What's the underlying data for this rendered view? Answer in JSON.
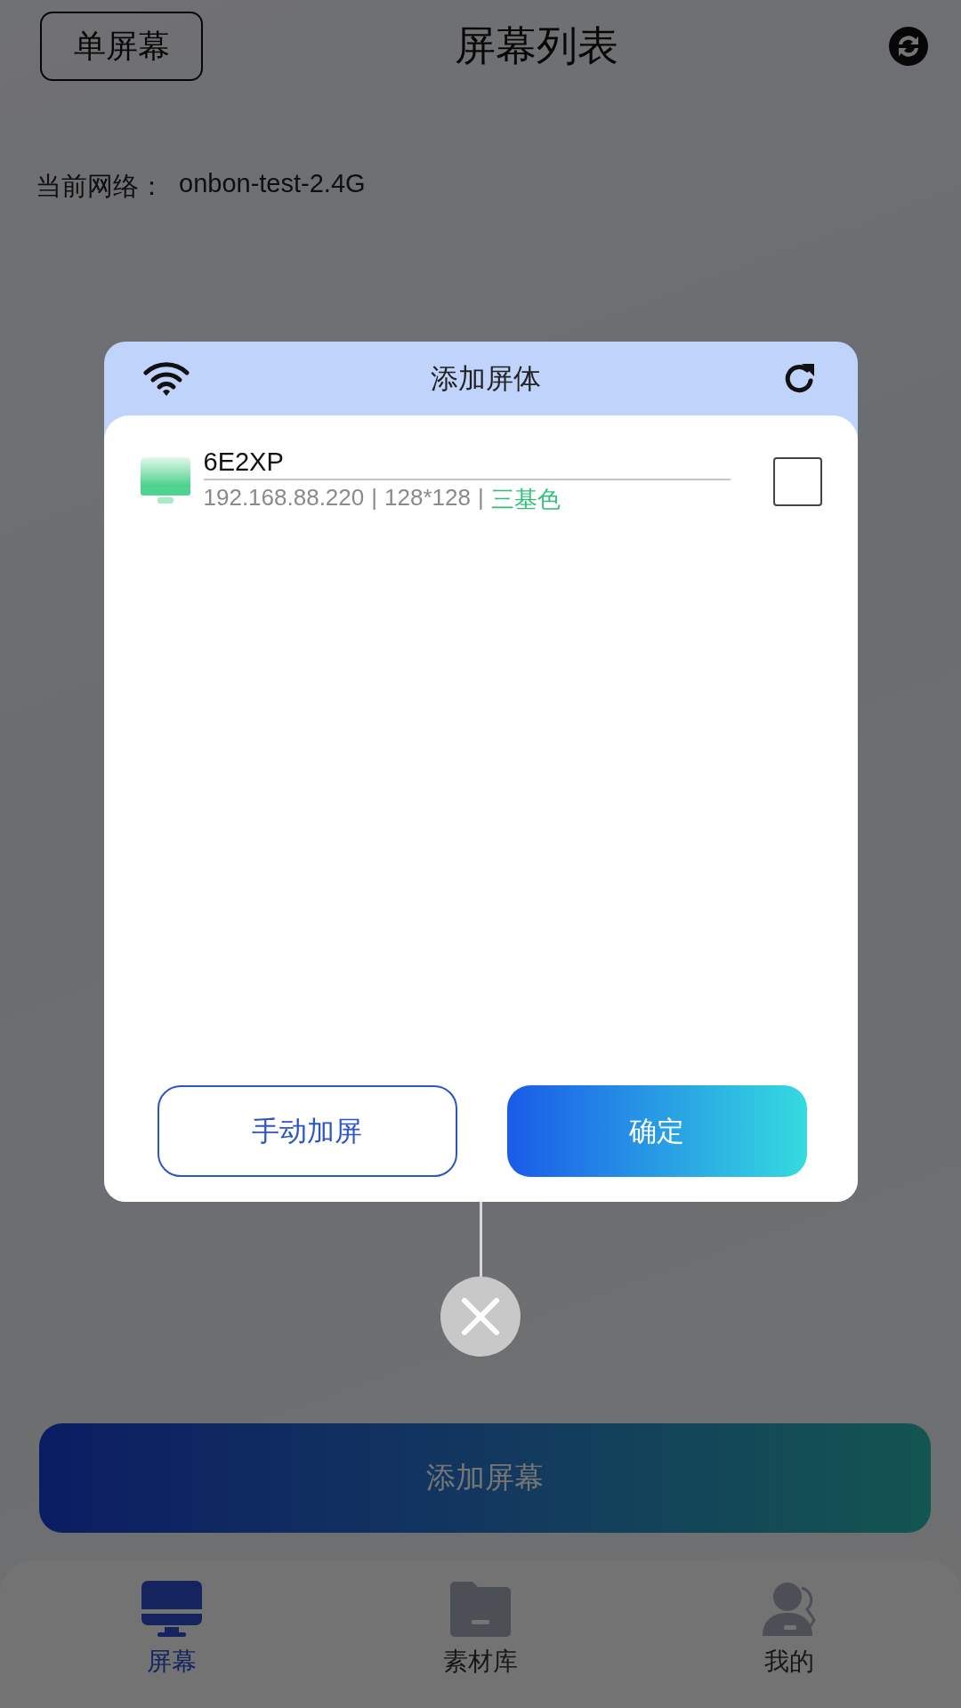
{
  "header": {
    "mode_button": "单屏幕",
    "title": "屏幕列表"
  },
  "network": {
    "label": "当前网络：",
    "value": "onbon-test-2.4G"
  },
  "add_screen_button": "添加屏幕",
  "tabs": [
    {
      "label": "屏幕",
      "kind": "screen",
      "selected": true
    },
    {
      "label": "素材库",
      "kind": "library",
      "selected": false
    },
    {
      "label": "我的",
      "kind": "profile",
      "selected": false
    }
  ],
  "dialog": {
    "title": "添加屏体",
    "devices": [
      {
        "name": "6E2XP",
        "details": [
          "192.168.88.220",
          "128*128"
        ],
        "separator": "|",
        "color_type": "三基色",
        "checked": false
      }
    ],
    "buttons": [
      {
        "label": "手动加屏",
        "kind": "outline"
      },
      {
        "label": "确定",
        "kind": "primary"
      }
    ]
  }
}
